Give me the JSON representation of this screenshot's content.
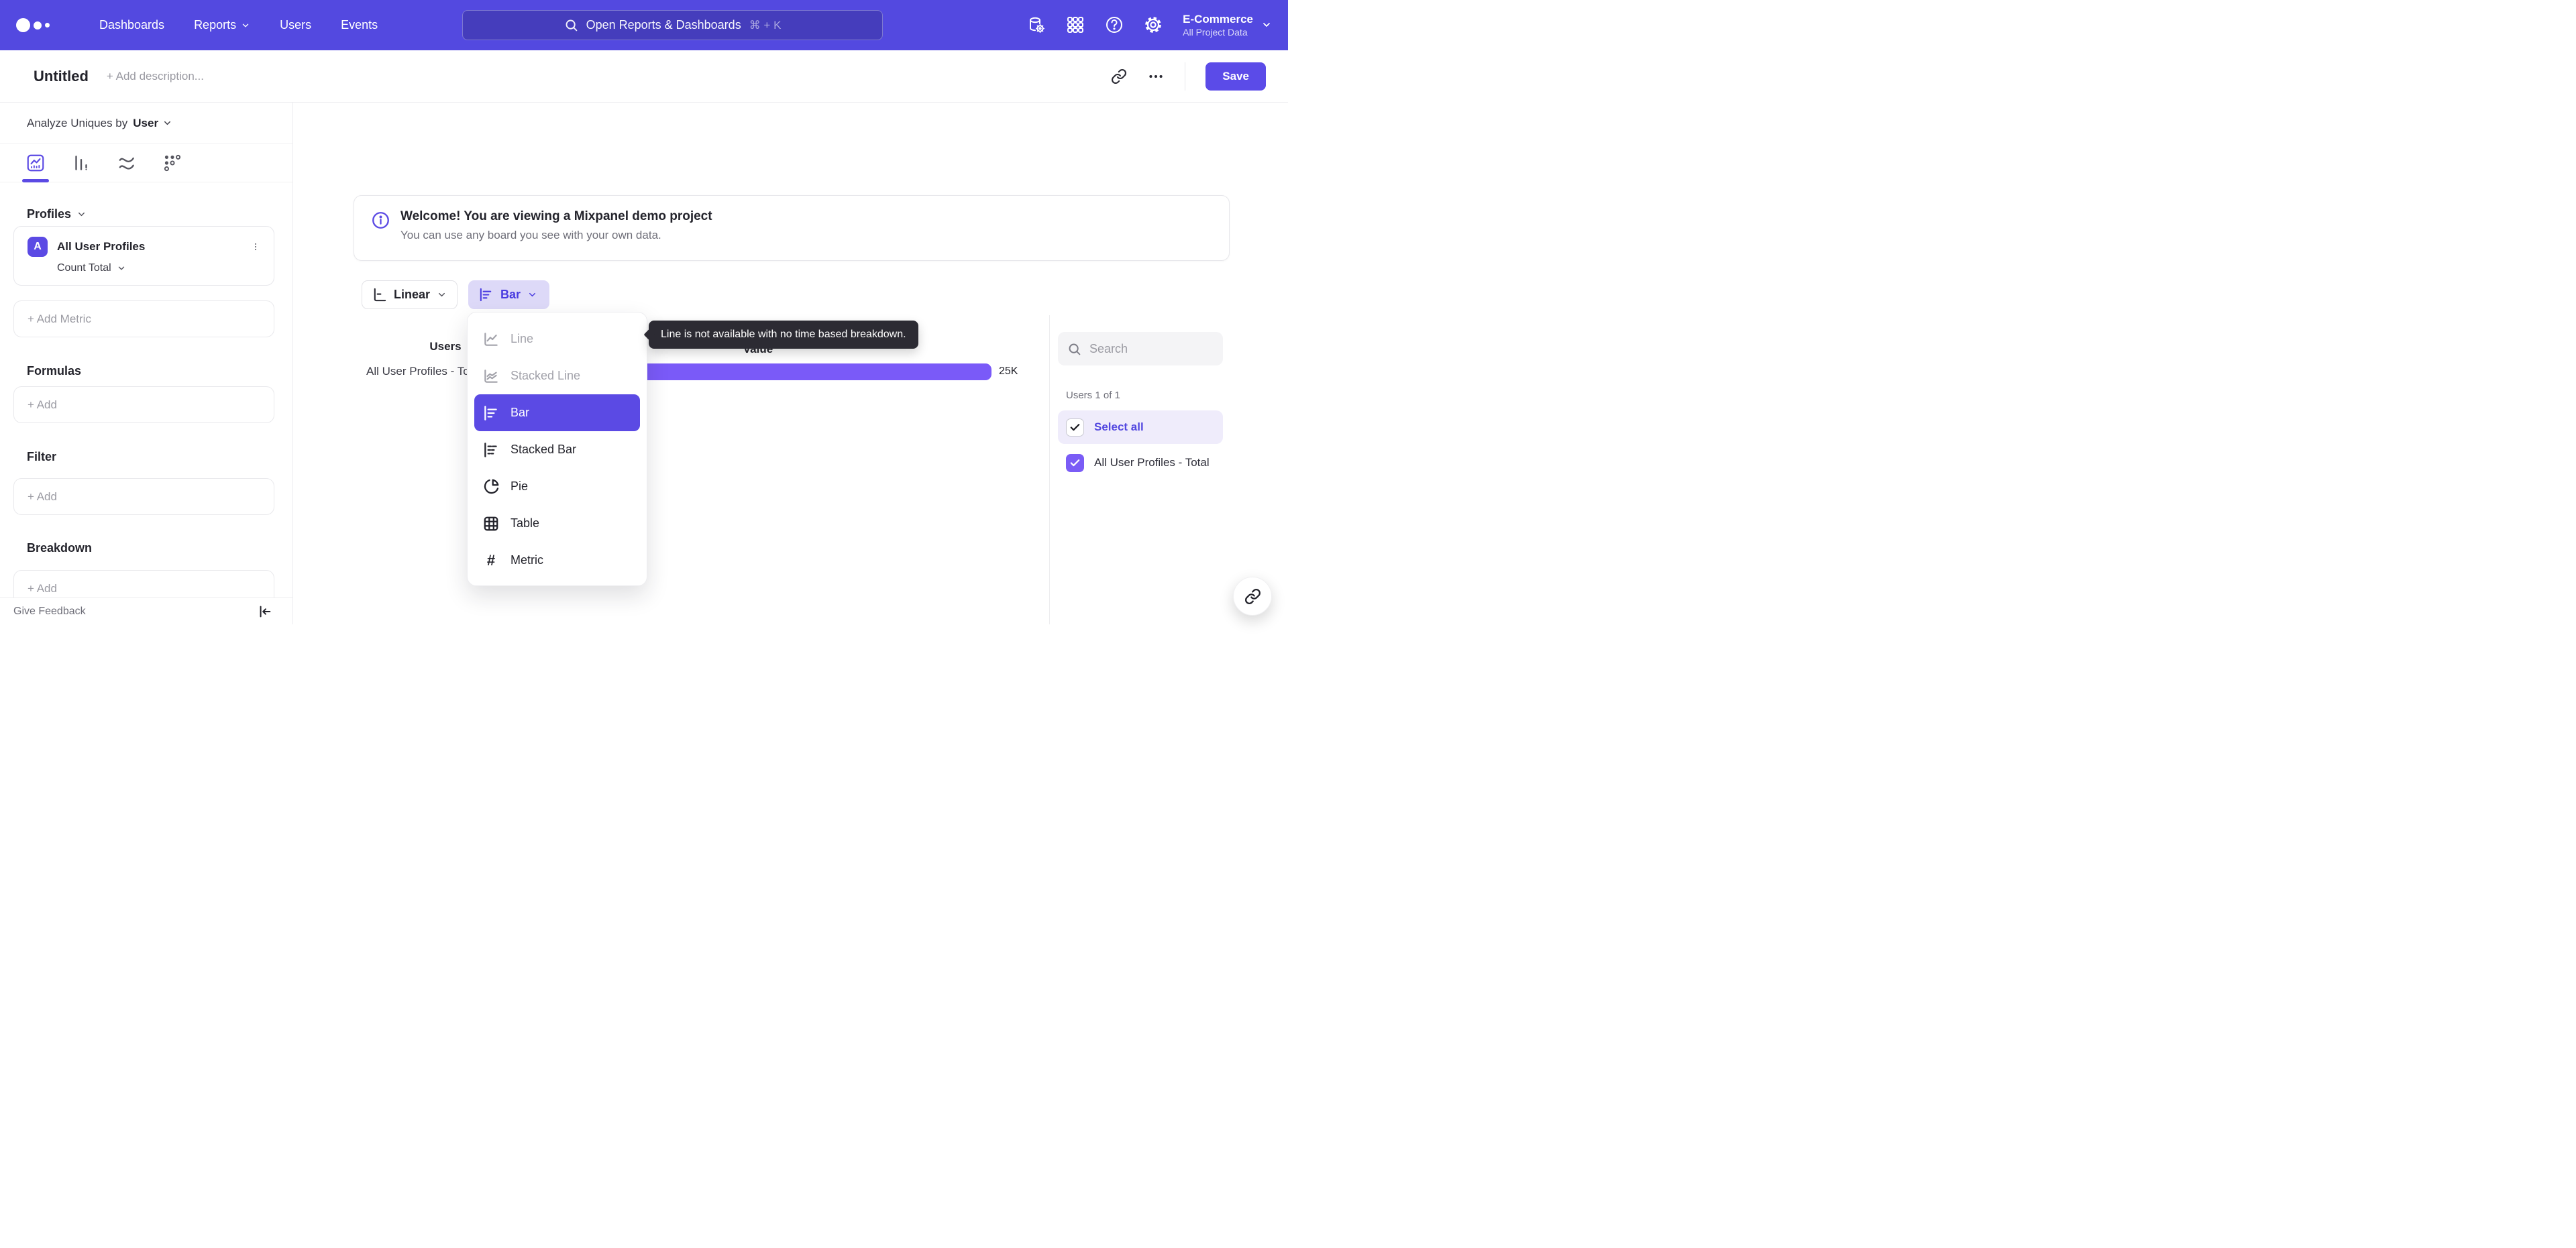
{
  "nav": {
    "items": [
      {
        "label": "Dashboards",
        "has_chevron": false
      },
      {
        "label": "Reports",
        "has_chevron": true
      },
      {
        "label": "Users",
        "has_chevron": false
      },
      {
        "label": "Events",
        "has_chevron": false
      }
    ],
    "search": {
      "placeholder": "Open Reports & Dashboards",
      "shortcut": "⌘ + K"
    },
    "icons": [
      "data-governance",
      "apps-grid",
      "help",
      "settings"
    ],
    "project": {
      "name": "E-Commerce",
      "scope": "All Project Data"
    }
  },
  "header": {
    "title": "Untitled",
    "description_placeholder": "+ Add description...",
    "save_label": "Save"
  },
  "sidebar": {
    "analyze_prefix": "Analyze Uniques by",
    "analyze_value": "User",
    "sections": {
      "profiles": "Profiles",
      "formulas": "Formulas",
      "filter": "Filter",
      "breakdown": "Breakdown"
    },
    "metric": {
      "badge": "A",
      "name": "All User Profiles",
      "aggregation": "Count Total"
    },
    "add_metric_label": "+ Add Metric",
    "add_label": "+ Add"
  },
  "footer": {
    "feedback_label": "Give Feedback"
  },
  "banner": {
    "title": "Welcome! You are viewing a Mixpanel demo project",
    "body": "You can use any board you see with your own data."
  },
  "controls": {
    "scale_label": "Linear",
    "chart_type_label": "Bar"
  },
  "dropdown": {
    "items": [
      {
        "label": "Line",
        "state": "disabled"
      },
      {
        "label": "Stacked Line",
        "state": "disabled"
      },
      {
        "label": "Bar",
        "state": "selected"
      },
      {
        "label": "Stacked Bar",
        "state": "normal"
      },
      {
        "label": "Pie",
        "state": "normal"
      },
      {
        "label": "Table",
        "state": "normal"
      },
      {
        "label": "Metric",
        "state": "normal"
      }
    ]
  },
  "tooltip": {
    "text": "Line is not available with no time based breakdown."
  },
  "chart": {
    "columns": [
      "Users",
      "Value"
    ],
    "rows": [
      {
        "label": "All User Profiles - Total",
        "value_label": "25K"
      }
    ]
  },
  "chart_data": {
    "type": "bar",
    "orientation": "horizontal",
    "title": "Users",
    "columns": [
      "Users",
      "Value"
    ],
    "categories": [
      "All User Profiles - Total"
    ],
    "values": [
      25000
    ],
    "value_labels": [
      "25K"
    ],
    "bar_color": "#7A5AF8",
    "xlim": [
      0,
      26000
    ],
    "grid": false,
    "legend": false
  },
  "right_panel": {
    "search_placeholder": "Search",
    "count_label": "Users 1 of 1",
    "select_all_label": "Select all",
    "items": [
      {
        "label": "All User Profiles - Total",
        "checked": true
      }
    ]
  },
  "colors": {
    "navbar": "#5349E0",
    "accent": "#5B4AE4",
    "bar_fill": "#7A5AF8",
    "chart_type_btn_bg": "#DDD9F8",
    "select_all_bg": "#EFECFB",
    "tooltip_bg": "#2C2B33"
  }
}
